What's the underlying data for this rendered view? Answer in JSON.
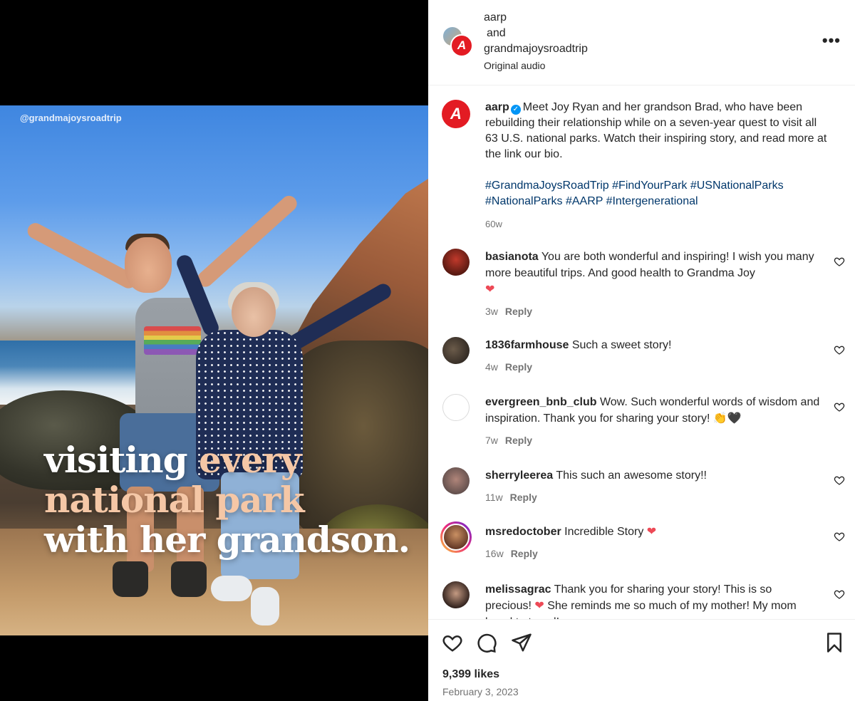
{
  "media": {
    "watermark": "@grandmajoysroadtrip",
    "overlay_line1_a": "visiting ",
    "overlay_line1_b": "every",
    "overlay_line2": "national park",
    "overlay_line3": "with her grandson."
  },
  "header": {
    "user1": "aarp",
    "and": "and",
    "user2": "grandmajoysroadtrip",
    "audio": "Original audio",
    "more": "•••",
    "avatar_letter": "A"
  },
  "caption": {
    "username": "aarp",
    "text": "Meet Joy Ryan and her grandson Brad, who have been rebuilding their relationship while on a seven-year quest to visit all 63 U.S. national parks. Watch their inspiring story, and read more at the link our bio.",
    "hashtags": "#GrandmaJoysRoadTrip #FindYourPark #USNationalParks #NationalParks #AARP #Intergenerational",
    "age": "60w",
    "avatar_letter": "A"
  },
  "comments": [
    {
      "username": "basianota",
      "text": "You are both wonderful and inspiring! I wish you many more beautiful trips. And good health to Grandma Joy",
      "emoji": "❤",
      "age": "3w",
      "reply": "Reply"
    },
    {
      "username": "1836farmhouse",
      "text": "Such a sweet story!",
      "emoji": "",
      "age": "4w",
      "reply": "Reply"
    },
    {
      "username": "evergreen_bnb_club",
      "text": "Wow. Such wonderful words of wisdom and inspiration. Thank you for sharing your story!",
      "emoji": "👏🖤",
      "age": "7w",
      "reply": "Reply"
    },
    {
      "username": "sherryleerea",
      "text": "This such an awesome story!!",
      "emoji": "",
      "age": "11w",
      "reply": "Reply"
    },
    {
      "username": "msredoctober",
      "text": "Incredible Story",
      "emoji": "❤",
      "age": "16w",
      "reply": "Reply"
    },
    {
      "username": "melissagrac",
      "text": "Thank you for sharing your story! This is so precious!",
      "emoji": "❤",
      "text2": "She reminds me so much of my mother! My mom loved to travel!",
      "age": "",
      "reply": ""
    }
  ],
  "footer": {
    "likes": "9,399 likes",
    "date": "February 3, 2023"
  },
  "colors": {
    "brand_red": "#e31b23",
    "hashtag_blue": "#00376b",
    "heart_red": "#ed4956",
    "verified_blue": "#0095f6"
  },
  "icons": [
    "like-icon",
    "comment-icon",
    "share-icon",
    "save-icon",
    "more-icon",
    "verified-icon",
    "heart-outline-icon"
  ]
}
